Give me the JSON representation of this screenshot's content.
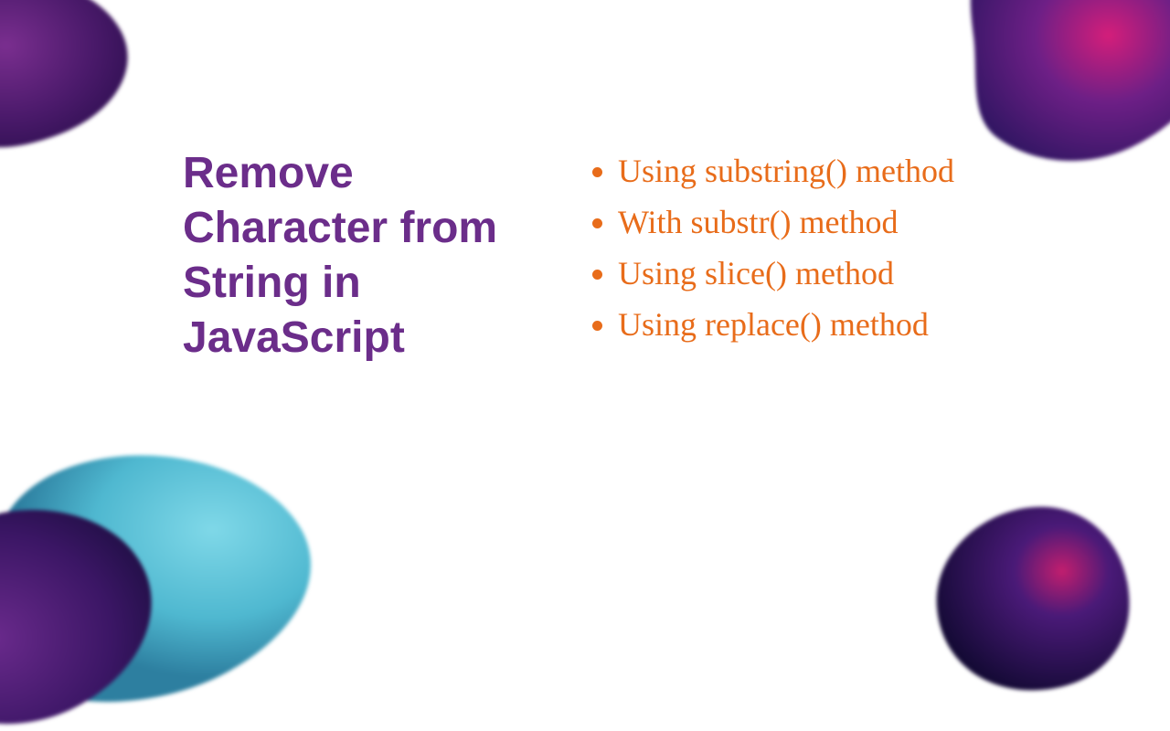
{
  "title": "Remove Character from String in JavaScript",
  "methods": [
    "Using substring() method",
    "With substr() method",
    "Using slice() method",
    "Using replace() method"
  ],
  "colors": {
    "title": "#6b2d8a",
    "list": "#e86c1a"
  }
}
